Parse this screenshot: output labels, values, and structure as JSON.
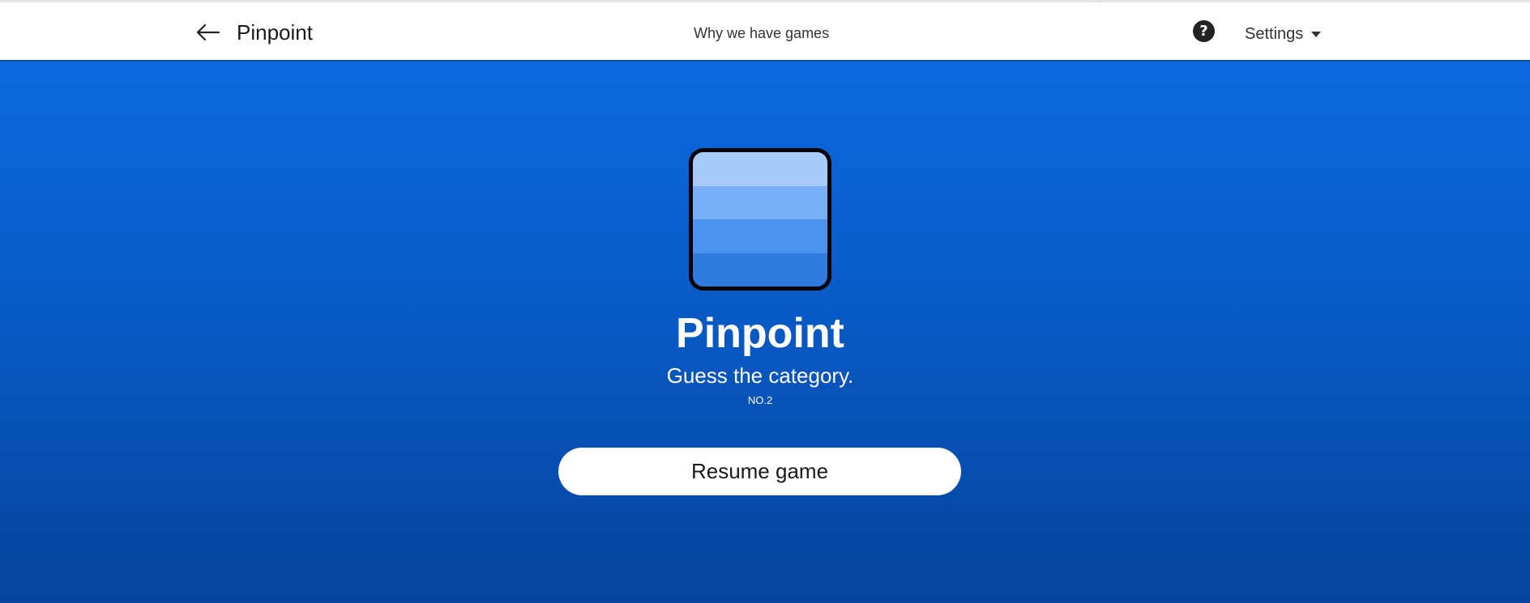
{
  "header": {
    "back_icon": "arrow-left-icon",
    "title": "Pinpoint",
    "why_link": "Why we have games",
    "help_icon": "question-circle-icon",
    "help_glyph": "?",
    "settings_label": "Settings",
    "settings_icon": "caret-down-icon"
  },
  "game": {
    "icon": "pinpoint-stack-icon",
    "title": "Pinpoint",
    "subtitle": "Guess the category.",
    "number": "NO.2",
    "resume_label": "Resume game"
  },
  "colors": {
    "background_top": "#0c6ce4",
    "background_bottom": "#04449c",
    "header_bg": "#ffffff",
    "icon_band_1": "#a8cbfb",
    "icon_band_2": "#7ab0f8",
    "icon_band_3": "#4c92ef",
    "icon_band_4": "#2f7bde"
  }
}
